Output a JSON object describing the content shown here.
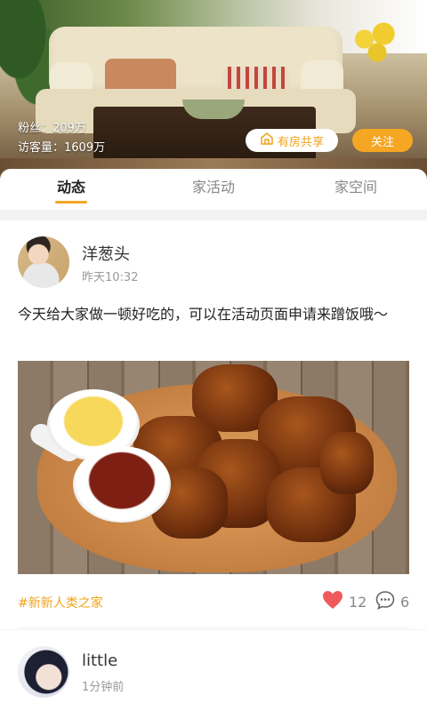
{
  "header": {
    "fans_label": "粉丝：209万",
    "visitors_label": "访客量：1609万",
    "share_button": "有房共享",
    "follow_button": "关注",
    "share_icon": "house-icon",
    "accent_color": "#f5a623"
  },
  "tabs": [
    {
      "label": "动态",
      "active": true
    },
    {
      "label": "家活动",
      "active": false
    },
    {
      "label": "家空间",
      "active": false
    }
  ],
  "posts": [
    {
      "username": "洋葱头",
      "time": "昨天10:32",
      "text": "今天给大家做一顿好吃的，可以在活动页面申请来蹭饭哦～",
      "tag": "#新新人类之家",
      "likes": "12",
      "comments": "6",
      "like_icon": "heart-icon",
      "comment_icon": "comment-bubble-icon"
    },
    {
      "username": "little",
      "time": "1分钟前"
    }
  ]
}
